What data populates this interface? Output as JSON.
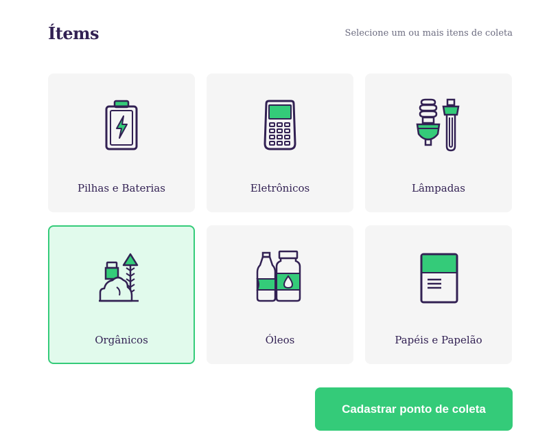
{
  "header": {
    "title": "Ítems",
    "subtitle": "Selecione um ou mais itens de coleta"
  },
  "items": [
    {
      "label": "Pilhas e Baterias",
      "icon": "battery-icon",
      "selected": false
    },
    {
      "label": "Eletrônicos",
      "icon": "electronic-device-icon",
      "selected": false
    },
    {
      "label": "Lâmpadas",
      "icon": "light-bulbs-icon",
      "selected": false
    },
    {
      "label": "Orgânicos",
      "icon": "organic-waste-icon",
      "selected": true
    },
    {
      "label": "Óleos",
      "icon": "oil-bottles-icon",
      "selected": false
    },
    {
      "label": "Papéis e Papelão",
      "icon": "paper-icon",
      "selected": false
    }
  ],
  "submit": {
    "label": "Cadastrar ponto de coleta"
  },
  "colors": {
    "primary": "#34cb79",
    "dark": "#322153",
    "card_bg": "#f5f5f5",
    "selected_bg": "#e1faec",
    "muted_text": "#6c6c80"
  }
}
